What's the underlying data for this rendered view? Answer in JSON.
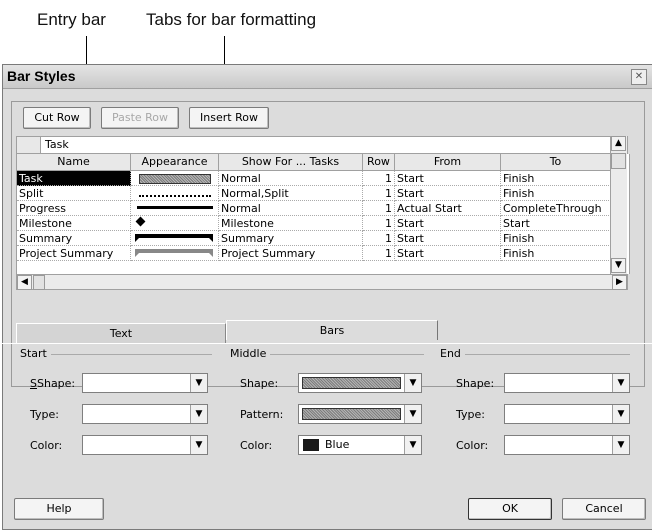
{
  "callouts": {
    "entry_bar": "Entry bar",
    "tabs_for_bar_formatting": "Tabs for bar formatting"
  },
  "dialog": {
    "title": "Bar Styles",
    "close_icon": "close-icon"
  },
  "toolbar": {
    "cut_row": "Cut Row",
    "paste_row": "Paste Row",
    "insert_row": "Insert Row"
  },
  "entry_bar": {
    "value": "Task"
  },
  "table": {
    "columns": [
      "Name",
      "Appearance",
      "Show For ... Tasks",
      "Row",
      "From",
      "To"
    ],
    "rows": [
      {
        "name": "Task",
        "appearance": "gray-bar",
        "show_for": "Normal",
        "row": "1",
        "from": "Start",
        "to": "Finish"
      },
      {
        "name": "Split",
        "appearance": "dotted-line",
        "show_for": "Normal,Split",
        "row": "1",
        "from": "Start",
        "to": "Finish"
      },
      {
        "name": "Progress",
        "appearance": "thin-black-bar",
        "show_for": "Normal",
        "row": "1",
        "from": "Actual Start",
        "to": "CompleteThrough"
      },
      {
        "name": "Milestone",
        "appearance": "diamond",
        "show_for": "Milestone",
        "row": "1",
        "from": "Start",
        "to": "Start"
      },
      {
        "name": "Summary",
        "appearance": "summary-bar",
        "show_for": "Summary",
        "row": "1",
        "from": "Start",
        "to": "Finish"
      },
      {
        "name": "Project Summary",
        "appearance": "gray-summary-bar",
        "show_for": "Project Summary",
        "row": "1",
        "from": "Start",
        "to": "Finish"
      }
    ]
  },
  "tabs": {
    "text": "Text",
    "bars": "Bars"
  },
  "start_group": {
    "label": "Start",
    "shape_label": "Shape:",
    "type_label": "Type:",
    "color_label": "Color:"
  },
  "middle_group": {
    "label": "Middle",
    "shape_label": "Shape:",
    "pattern_label": "Pattern:",
    "color_label": "Color:",
    "color_value": "Blue"
  },
  "end_group": {
    "label": "End",
    "shape_label": "Shape:",
    "type_label": "Type:",
    "color_label": "Color:"
  },
  "footer": {
    "help": "Help",
    "ok": "OK",
    "cancel": "Cancel"
  }
}
